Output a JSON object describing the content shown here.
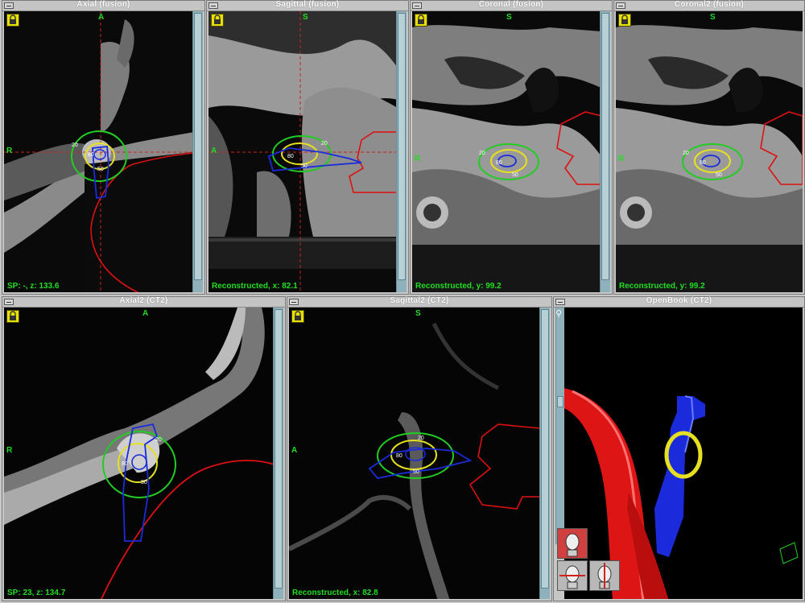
{
  "panels": {
    "axial": {
      "title": "Axial (fusion)",
      "top": "A",
      "left": "R",
      "status": "SP: -, z: 133.6"
    },
    "sagittal": {
      "title": "Sagittal (fusion)",
      "top": "S",
      "left": "A",
      "status": "Reconstructed, x: 82.1"
    },
    "coronal": {
      "title": "Coronal (fusion)",
      "top": "S",
      "left": "R",
      "status": "Reconstructed, y: 99.2"
    },
    "coronal2": {
      "title": "Coronal2 (fusion)",
      "top": "S",
      "left": "R",
      "status": "Reconstructed, y: 99.2"
    },
    "axial2": {
      "title": "Axial2 (CT2)",
      "top": "A",
      "left": "R",
      "status": "SP: 23, z: 134.7"
    },
    "sagittal2": {
      "title": "Sagittal2 (CT2)",
      "top": "S",
      "left": "A",
      "status": "Reconstructed, x: 82.8"
    },
    "openbook": {
      "title": "OpenBook (CT2)"
    }
  },
  "isodose_labels": {
    "outer": "20",
    "middle": "80",
    "inner": "50"
  },
  "colors": {
    "status_text": "#22dd22",
    "isodose_20": "#22cc22",
    "isodose_50": "#e6e020",
    "target": "#1a2bdc",
    "organ": "#dd1111",
    "crosshair": "#cc2222",
    "scrollbar": "#8fb1bb"
  },
  "icons": {
    "lock": "lock-icon",
    "minimize": "minimize-icon",
    "pin": "pin-icon",
    "head_views": [
      "head-view-icon-1",
      "head-view-icon-2",
      "head-view-icon-3"
    ],
    "axes_cube": "axes-cube-icon"
  }
}
